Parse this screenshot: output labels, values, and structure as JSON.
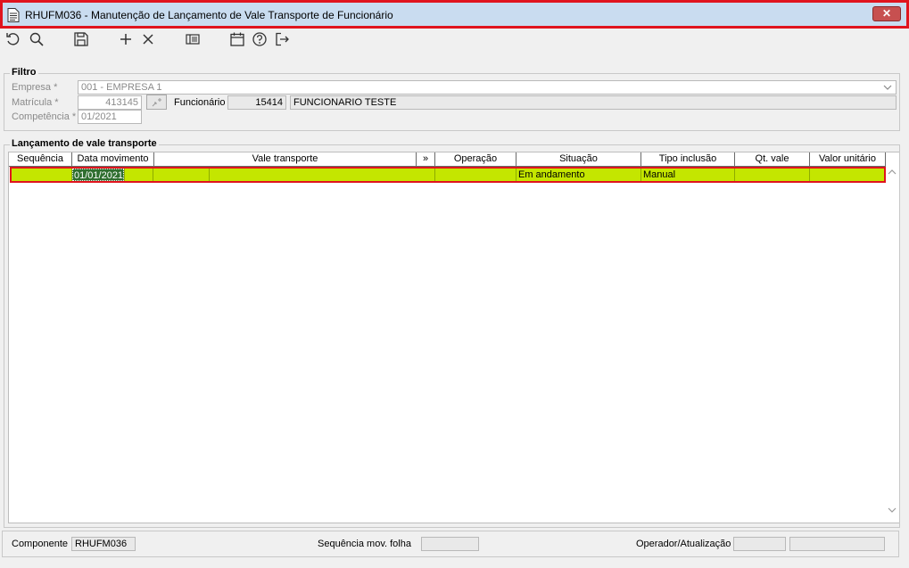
{
  "window": {
    "title": "RHUFM036 - Manutenção de Lançamento de Vale Transporte de Funcionário",
    "close_label": "✕"
  },
  "toolbar": {
    "icons": [
      "undo-icon",
      "search-icon",
      "save-icon",
      "add-icon",
      "delete-icon",
      "list-icon",
      "calendar-icon",
      "help-icon",
      "exit-icon"
    ]
  },
  "filtro": {
    "title": "Filtro",
    "empresa_label": "Empresa *",
    "empresa_value": "001 - EMPRESA 1",
    "matricula_label": "Matrícula *",
    "matricula_value": "413145",
    "funcionario_label": "Funcionário",
    "funcionario_code": "15414",
    "funcionario_name": "FUNCIONARIO TESTE",
    "competencia_label": "Competência *",
    "competencia_value": "01/2021"
  },
  "lancamento": {
    "title": "Lançamento de vale transporte",
    "columns": [
      "Sequência",
      "Data movimento",
      "Vale transporte",
      "»",
      "Operação",
      "Situação",
      "Tipo inclusão",
      "Qt. vale",
      "Valor unitário"
    ],
    "rows": [
      {
        "sequencia": "",
        "data_movimento": "01/01/2021",
        "vale_codigo": "",
        "vale_descricao": "",
        "operacao": "",
        "situacao": "Em andamento",
        "tipo_inclusao": "Manual",
        "qt_vale": "",
        "valor_unitario": ""
      }
    ]
  },
  "footer": {
    "componente_label": "Componente",
    "componente_value": "RHUFM036",
    "seq_label": "Sequência mov. folha",
    "seq_value": "",
    "operador_label": "Operador/Atualização",
    "operador_value": "",
    "atualizacao_value": ""
  },
  "colors": {
    "title_bg": "#c9dcf0",
    "highlight": "#e0141e",
    "row_bg": "#c4e600",
    "selected_cell": "#2f6e2f"
  }
}
